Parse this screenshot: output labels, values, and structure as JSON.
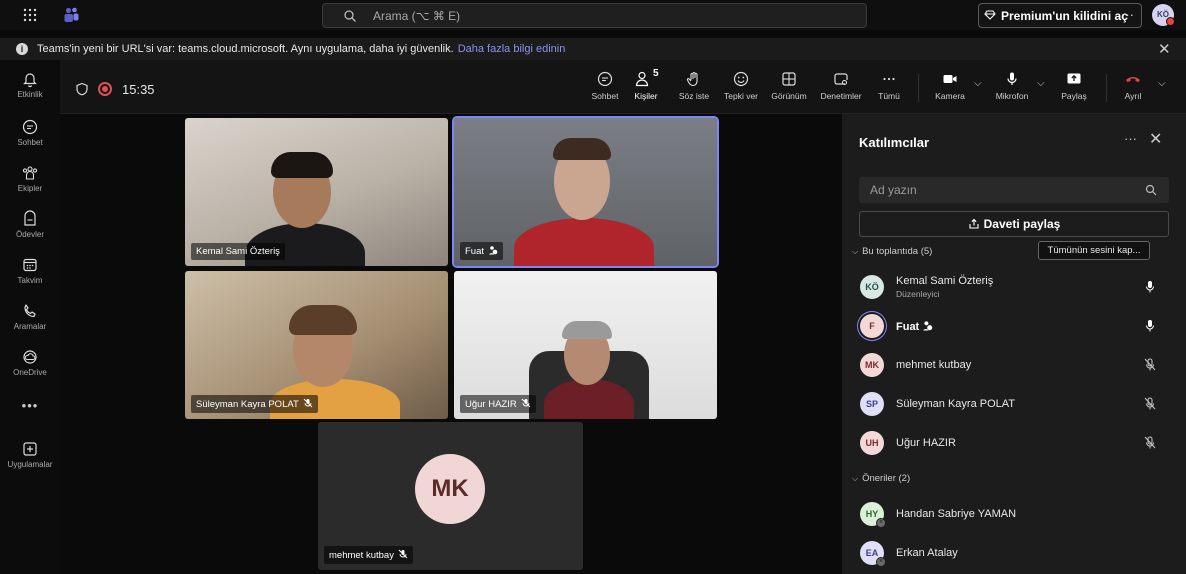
{
  "titlebar": {
    "search_placeholder": "Arama (⌥ ⌘ E)",
    "premium_label": "Premium'un kilidini aç",
    "more": "···",
    "user_initials": "KÖ"
  },
  "banner": {
    "text": "Teams'in yeni bir URL'si var: teams.cloud.microsoft. Aynı uygulama, daha iyi güvenlik.",
    "link": "Daha fazla bilgi edinin",
    "close": "✕"
  },
  "rail": {
    "items": [
      {
        "label": "Etkinlik",
        "icon": "bell-icon"
      },
      {
        "label": "Sohbet",
        "icon": "chat-icon"
      },
      {
        "label": "Ekipler",
        "icon": "teams-icon"
      },
      {
        "label": "Ödevler",
        "icon": "assignments-icon"
      },
      {
        "label": "Takvim",
        "icon": "calendar-icon"
      },
      {
        "label": "Aramalar",
        "icon": "phone-icon"
      },
      {
        "label": "OneDrive",
        "icon": "cloud-icon"
      },
      {
        "label": "Uygulamalar",
        "icon": "apps-icon"
      }
    ],
    "more": "•••"
  },
  "meeting": {
    "timer": "15:35",
    "people_count": "5",
    "tools": {
      "chat": "Sohbet",
      "people": "Kişiler",
      "raise": "Söz iste",
      "react": "Tepki ver",
      "view": "Görünüm",
      "controls": "Denetimler",
      "more": "Tümü",
      "camera": "Kamera",
      "mic": "Mikrofon",
      "share": "Paylaş",
      "leave": "Ayrıl"
    }
  },
  "tiles": [
    {
      "name": "Kemal Sami Özteriş"
    },
    {
      "name": "Fuat"
    },
    {
      "name": "Süleyman Kayra POLAT"
    },
    {
      "name": "Uğur HAZIR"
    },
    {
      "name": "mehmet kutbay",
      "initials": "MK"
    }
  ],
  "panel": {
    "title": "Katılımcılar",
    "more": "···",
    "close": "✕",
    "search_placeholder": "Ad yazın",
    "share_invite": "Daveti paylaş",
    "in_meeting": "Bu toplantıda (5)",
    "mute_all": "Tümünün sesini kap...",
    "suggestions": "Öneriler (2)",
    "participants": [
      {
        "initials": "KÖ",
        "name": "Kemal Sami Özteriş",
        "role": "Düzenleyici"
      },
      {
        "initials": "F",
        "name": "Fuat"
      },
      {
        "initials": "MK",
        "name": "mehmet kutbay"
      },
      {
        "initials": "SP",
        "name": "Süleyman Kayra POLAT"
      },
      {
        "initials": "UH",
        "name": "Uğur HAZIR"
      }
    ],
    "suggested": [
      {
        "initials": "HY",
        "name": "Handan Sabriye YAMAN"
      },
      {
        "initials": "EA",
        "name": "Erkan Atalay"
      }
    ]
  }
}
